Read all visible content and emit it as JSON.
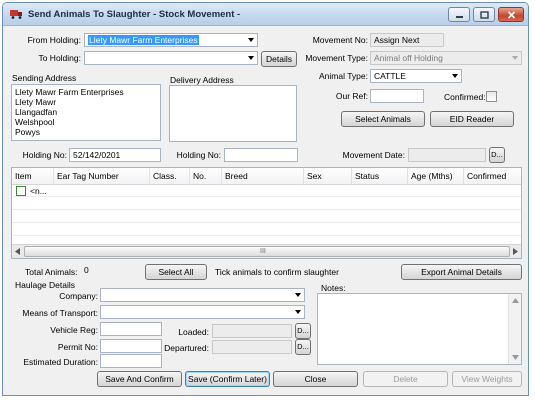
{
  "window": {
    "title": "Send Animals To Slaughter - Stock Movement -"
  },
  "header": {
    "from_holding_label": "From Holding:",
    "from_holding_value": "Llety Mawr Farm Enterprises",
    "to_holding_label": "To Holding:",
    "to_holding_value": "",
    "details_button": "Details",
    "movement_no_label": "Movement No:",
    "movement_no_value": "Assign Next",
    "movement_type_label": "Movement Type:",
    "movement_type_value": "Animal off Holding",
    "animal_type_label": "Animal Type:",
    "animal_type_value": "CATTLE",
    "our_ref_label": "Our Ref:",
    "our_ref_value": "",
    "confirmed_label": "Confirmed:",
    "select_animals_button": "Select Animals",
    "eid_reader_button": "EID Reader"
  },
  "address": {
    "sending_label": "Sending Address",
    "sending_lines": [
      "Llety Mawr Farm Enterprises",
      "Llety Mawr",
      "Llangadfan",
      "Welshpool",
      "Powys"
    ],
    "delivery_label": "Delivery Address",
    "holding_no_label": "Holding No:",
    "holding_no_value": "52/142/0201",
    "delivery_holding_no_label": "Holding No:",
    "delivery_holding_no_value": "",
    "movement_date_label": "Movement Date:",
    "date_button": "D..."
  },
  "grid": {
    "columns": [
      "Item",
      "Ear Tag Number",
      "Class.",
      "No.",
      "Breed",
      "Sex",
      "Status",
      "Age (Mths)",
      "Confirmed"
    ],
    "first_row_text": "<n...",
    "scroll_grip": "III"
  },
  "summary": {
    "total_label": "Total Animals:",
    "total_value": "0",
    "select_all_button": "Select All",
    "tick_text": "Tick animals to confirm slaughter",
    "export_button": "Export Animal Details"
  },
  "haulage": {
    "section_label": "Haulage Details",
    "company_label": "Company:",
    "means_label": "Means of Transport:",
    "vehicle_label": "Vehicle Reg:",
    "permit_label": "Permit No:",
    "duration_label": "Estimated Duration:",
    "loaded_label": "Loaded:",
    "departured_label": "Departured:",
    "date_button": "D...",
    "notes_label": "Notes:"
  },
  "footer": {
    "save_confirm": "Save And Confirm",
    "save_later": "Save (Confirm Later)",
    "close": "Close",
    "delete": "Delete",
    "view_weights": "View Weights"
  }
}
